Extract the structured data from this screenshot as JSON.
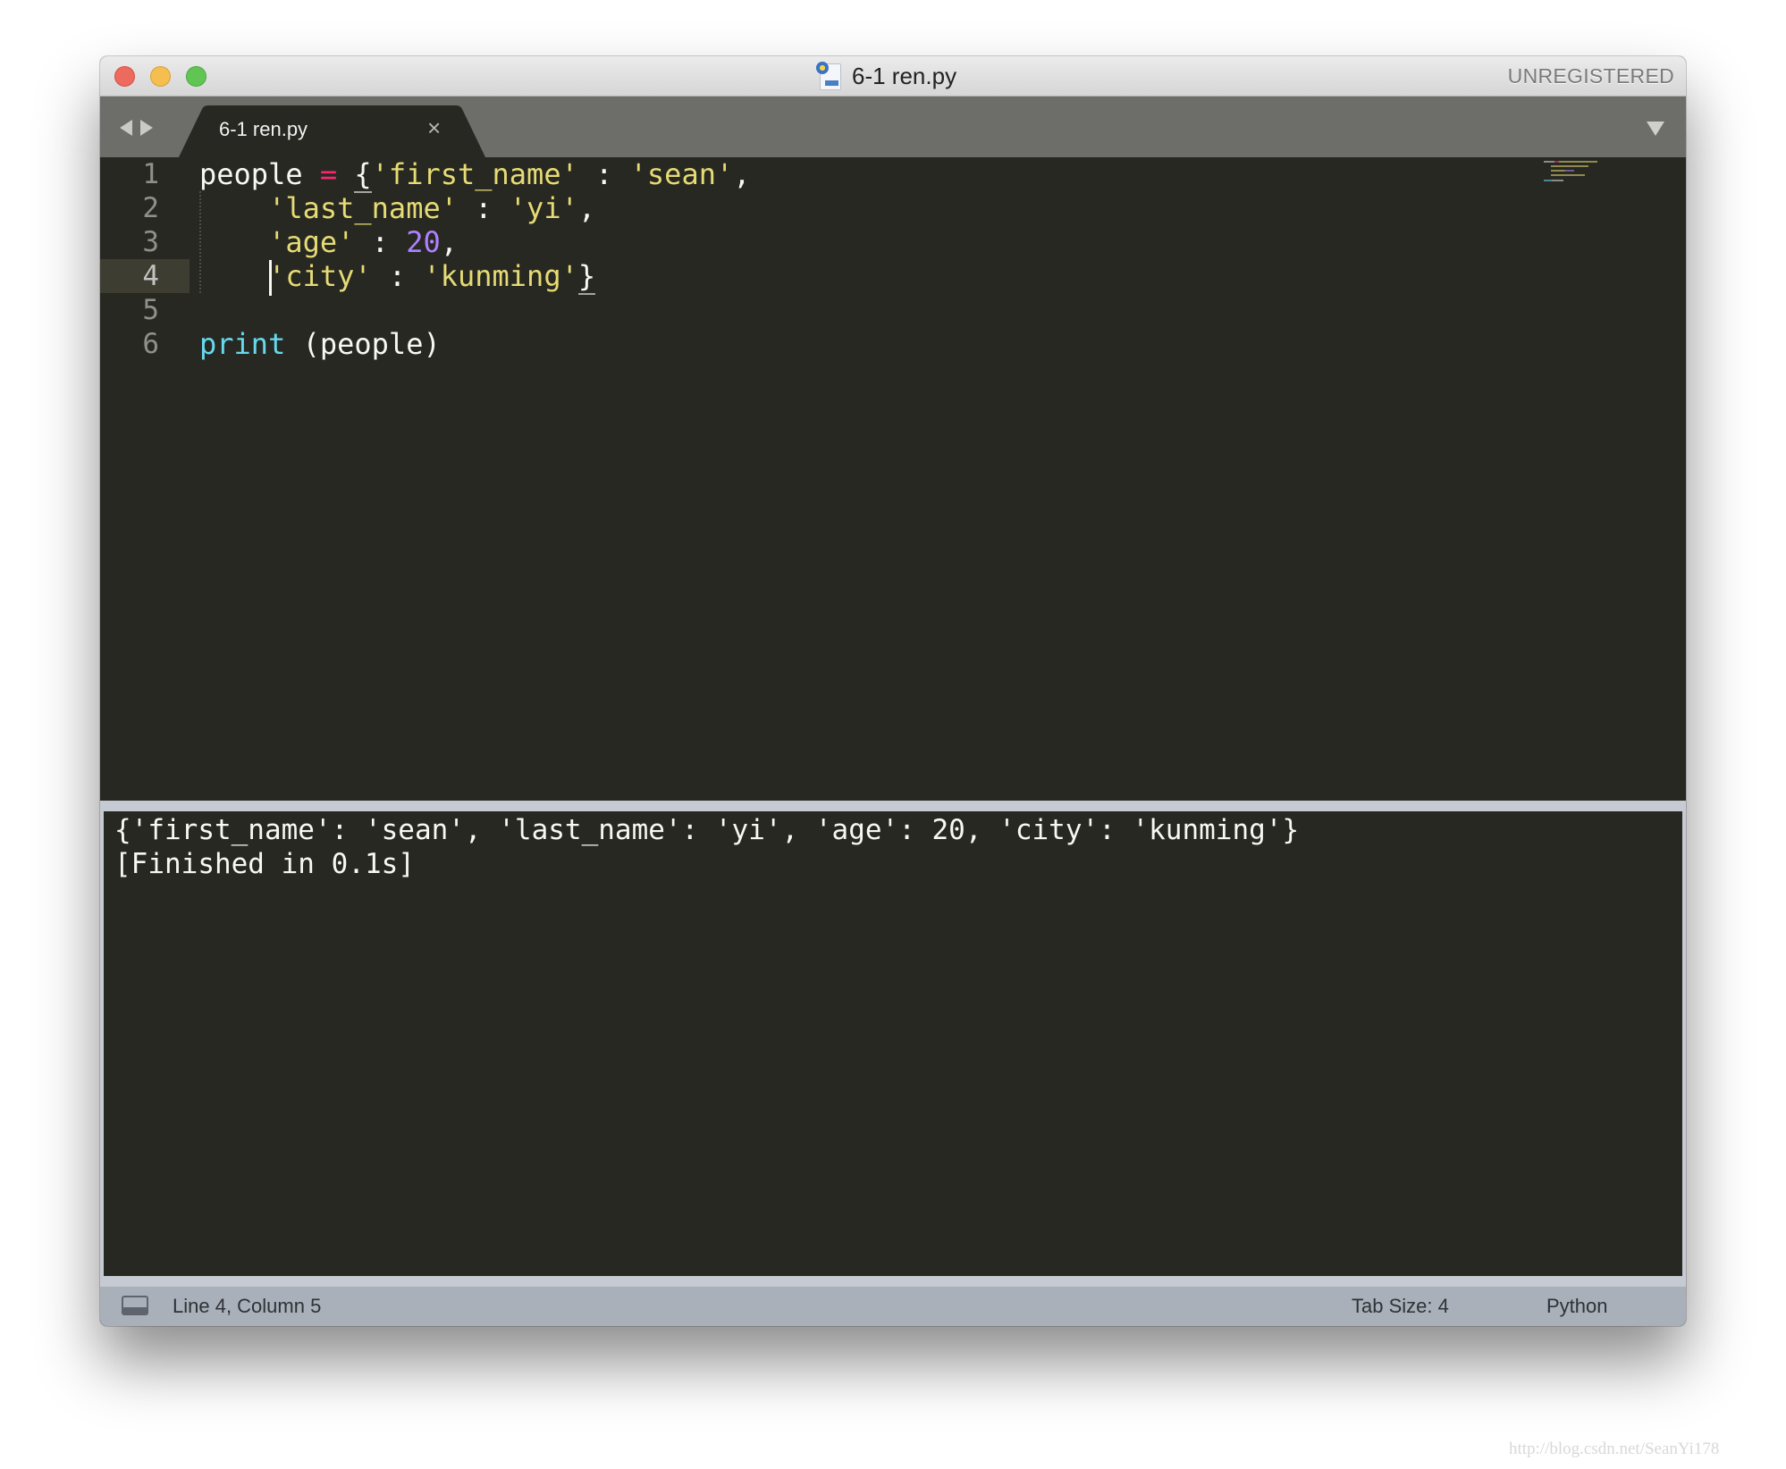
{
  "window": {
    "title": "6-1 ren.py",
    "title_icon": "python-file-icon",
    "registration_label": "UNREGISTERED"
  },
  "tabs": [
    {
      "label": "6-1 ren.py",
      "active": true,
      "close_icon": "×"
    }
  ],
  "editor": {
    "language": "Python",
    "current_line": 4,
    "lines": [
      {
        "number": "1",
        "text": "people = {'first_name' : 'sean',"
      },
      {
        "number": "2",
        "text": "    'last_name' : 'yi',"
      },
      {
        "number": "3",
        "text": "    'age' : 20,"
      },
      {
        "number": "4",
        "text": "    'city' : 'kunming'}"
      },
      {
        "number": "5",
        "text": ""
      },
      {
        "number": "6",
        "text": "print (people)"
      }
    ],
    "tokens": {
      "l1_ident": "people",
      "l1_op": "=",
      "l1_brace": "{",
      "l1_key": "'first_name'",
      "l1_colon": ":",
      "l1_val": "'sean'",
      "l1_comma": ",",
      "l2_key": "'last_name'",
      "l2_colon": ":",
      "l2_val": "'yi'",
      "l2_comma": ",",
      "l3_key": "'age'",
      "l3_colon": ":",
      "l3_val": "20",
      "l3_comma": ",",
      "l4_key": "'city'",
      "l4_colon": ":",
      "l4_val": "'kunming'",
      "l4_brace": "}",
      "l6_kw": "print",
      "l6_args": "(people)"
    }
  },
  "output_panel": {
    "lines": [
      "{'first_name': 'sean', 'last_name': 'yi', 'age': 20, 'city': 'kunming'}",
      "[Finished in 0.1s]"
    ]
  },
  "status_bar": {
    "position": "Line 4, Column 5",
    "tab_size": "Tab Size: 4",
    "syntax": "Python"
  },
  "colors": {
    "editor_bg": "#272822",
    "string": "#e6db74",
    "operator": "#f92672",
    "number": "#ae81ff",
    "builtin": "#66d9ef",
    "text": "#f8f8f2"
  },
  "watermark": "http://blog.csdn.net/SeanYi178"
}
